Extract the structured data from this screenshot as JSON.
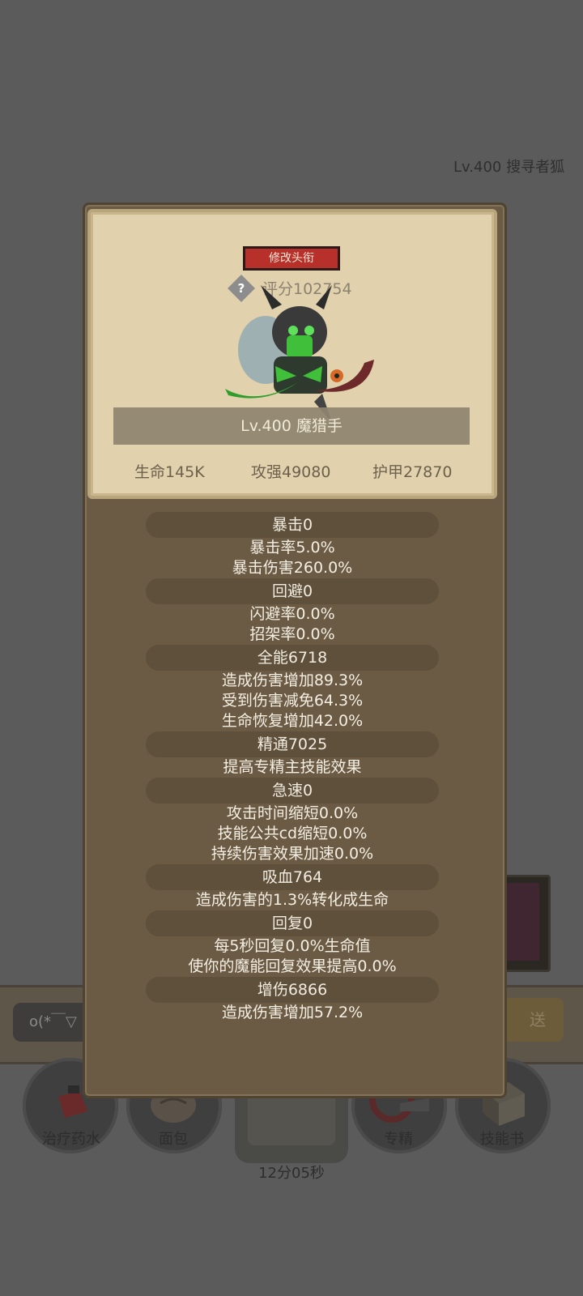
{
  "background": {
    "top_right_text": "Lv.400 搜寻者狐",
    "chat_input_placeholder": "o(*￣▽",
    "send_label": "送",
    "bottom_buttons": [
      {
        "label": "治疗药水",
        "icon": "potion-icon"
      },
      {
        "label": "面包",
        "icon": "bread-icon"
      },
      {
        "label": "12分05秒",
        "icon": "chest-icon"
      },
      {
        "label": "专精",
        "icon": "specialization-icon"
      },
      {
        "label": "技能书",
        "icon": "skill-book-icon"
      }
    ]
  },
  "profile": {
    "edit_title_label": "修改头衔",
    "score_label": "评分102754",
    "help_symbol": "?",
    "level_name": "Lv.400 魔猎手",
    "stats": {
      "hp": "生命145K",
      "attack": "攻强49080",
      "armor": "护甲27870"
    }
  },
  "sections": [
    {
      "header": "暴击0",
      "lines": [
        "暴击率5.0%",
        "暴击伤害260.0%"
      ]
    },
    {
      "header": "回避0",
      "lines": [
        "闪避率0.0%",
        "招架率0.0%"
      ]
    },
    {
      "header": "全能6718",
      "lines": [
        "造成伤害增加89.3%",
        "受到伤害减免64.3%",
        "生命恢复增加42.0%"
      ]
    },
    {
      "header": "精通7025",
      "lines": [
        "提高专精主技能效果"
      ]
    },
    {
      "header": "急速0",
      "lines": [
        "攻击时间缩短0.0%",
        "技能公共cd缩短0.0%",
        "持续伤害效果加速0.0%"
      ]
    },
    {
      "header": "吸血764",
      "lines": [
        "造成伤害的1.3%转化成生命"
      ]
    },
    {
      "header": "回复0",
      "lines": [
        "每5秒回复0.0%生命值",
        "使你的魔能回复效果提高0.0%"
      ]
    },
    {
      "header": "增伤6866",
      "lines": [
        "造成伤害增加57.2%"
      ]
    }
  ],
  "colors": {
    "panel": "#6b5b44",
    "parchment": "#e1d2ad",
    "title_button": "#b8302a",
    "fel_green": "#3fbf3a"
  }
}
